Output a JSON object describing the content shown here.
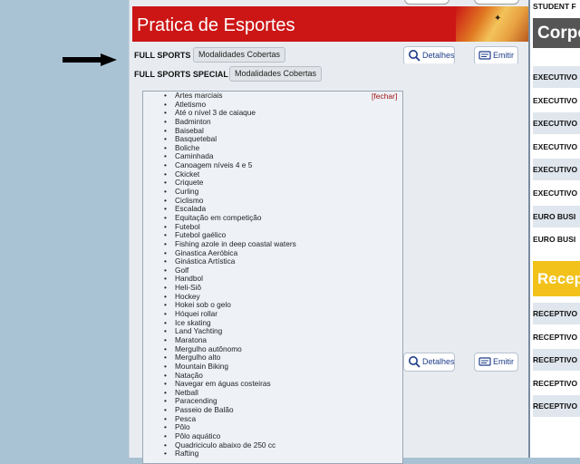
{
  "banner": {
    "title": "Pratica de Esportes"
  },
  "rows": [
    {
      "label": "FULL SPORTS",
      "coverage_button": "Modalidades Cobertas",
      "details_button": "Detalhes",
      "emit_button": "Emitir"
    },
    {
      "label": "FULL SPORTS SPECIAL",
      "coverage_button": "Modalidades Cobertas"
    }
  ],
  "list_panel": {
    "close_link": "[fechar]",
    "items": [
      "Artes marciais",
      "Atletismo",
      "Até o nível 3 de caiaque",
      "Badminton",
      "Baisebal",
      "Basquetebal",
      "Boliche",
      "Caminhada",
      "Canoagem níveis 4 e 5",
      "Ckicket",
      "Criquete",
      "Curling",
      "Ciclismo",
      "Escalada",
      "Equitação em competição",
      "Futebol",
      "Futebol gaélico",
      "Fishing azole in deep coastal waters",
      "Ginastica Aeróbica",
      "Ginástica Artística",
      "Golf",
      "Handbol",
      "Heli-Siô",
      "Hockey",
      "Hokei sob o gelo",
      "Hóquei rollar",
      "Ice skating",
      "Land Yachting",
      "Maratona",
      "Mergulho autônomo",
      "Mergulho alto",
      "Mountain Biking",
      "Natação",
      "Navegar em águas costeiras",
      "Netball",
      "Paracending",
      "Passeio de Balão",
      "Pesca",
      "Pôlo",
      "Pôlo aquático",
      "Quadriciculo abaixo de 250 cc",
      "Rafting"
    ]
  },
  "second_buttons": {
    "details_button": "Detalhes",
    "emit_button": "Emitir"
  },
  "right_panel": {
    "header": "STUDENT F",
    "corp_banner": "Corpo",
    "items_a": [
      "EXECUTIVO",
      "EXECUTIVO",
      "EXECUTIVO",
      "EXECUTIVO",
      "EXECUTIVO",
      "EXECUTIVO",
      "EURO BUSI",
      "EURO BUSI"
    ],
    "recep_banner": "Recep",
    "items_b": [
      "RECEPTIVO",
      "RECEPTIVO",
      "RECEPTIVO",
      "RECEPTIVO",
      "RECEPTIVO"
    ]
  },
  "colors": {
    "banner_red": "#cc1616",
    "link_blue": "#1c3c88",
    "recep_yellow": "#f2c21a"
  }
}
